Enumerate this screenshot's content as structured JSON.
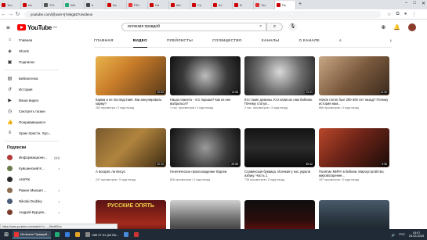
{
  "browser": {
    "tabs": [
      {
        "label": "Тес",
        "color": "#c00"
      },
      {
        "label": "Ис",
        "color": "#c00"
      },
      {
        "label": "TCI",
        "color": "#555"
      },
      {
        "label": "Wh",
        "color": "#2a7"
      },
      {
        "label": "b",
        "color": "#444"
      },
      {
        "label": "Ка",
        "color": "#c00"
      },
      {
        "label": "PDI",
        "color": "#e33"
      },
      {
        "label": "Св",
        "color": "#c00"
      },
      {
        "label": "Ма",
        "color": "#c00"
      },
      {
        "label": "Се",
        "color": "#c00"
      },
      {
        "label": "Ко",
        "color": "#c00"
      },
      {
        "label": "Ф",
        "color": "#c00"
      },
      {
        "label": "Тес",
        "color": "#d33"
      },
      {
        "label": "Ра",
        "color": "#c00"
      }
    ],
    "url": "youtube.com/@user-tj7w6ga57u/videos",
    "status_url": "https://www.youtube.com/watch?v=..._Sbe65Xzs"
  },
  "youtube": {
    "logo_text": "YouTube",
    "logo_region": "RU",
    "search_value": "иллюзия правдой",
    "search_clear": "×"
  },
  "sidebar": {
    "items": [
      {
        "label": "Главная",
        "icon": "home-icon",
        "glyph": "⌂"
      },
      {
        "label": "Shorts",
        "icon": "shorts-icon",
        "glyph": "◈"
      },
      {
        "label": "Подписки",
        "icon": "subscriptions-icon",
        "glyph": "▣"
      }
    ],
    "items2": [
      {
        "label": "Библиотека",
        "icon": "library-icon",
        "glyph": "▤"
      },
      {
        "label": "История",
        "icon": "history-icon",
        "glyph": "↺"
      },
      {
        "label": "Ваши видео",
        "icon": "your-videos-icon",
        "glyph": "▶"
      },
      {
        "label": "Смотреть позже",
        "icon": "watch-later-icon",
        "glyph": "◷"
      },
      {
        "label": "Понравившиеся",
        "icon": "liked-icon",
        "glyph": "👍"
      },
      {
        "label": "Храм Христа. Хро...",
        "icon": "playlist-icon",
        "glyph": "≡"
      }
    ],
    "subs_heading": "Подписки",
    "subs": [
      {
        "label": "Информационн...",
        "color": "#b23b3b",
        "live": "((•))"
      },
      {
        "label": "Кувшинский К...",
        "color": "#6a7b4a",
        "live": "•"
      },
      {
        "label": "AISPIK",
        "color": "#2c2c2c",
        "live": ""
      },
      {
        "label": "Ражин Михаил ...",
        "color": "#8a6d52",
        "live": "•"
      },
      {
        "label": "Nikolai Dudsky",
        "color": "#4b5d7a",
        "live": "•"
      },
      {
        "label": "Андрей Бурцев...",
        "color": "#7a3c2c",
        "live": "•"
      }
    ]
  },
  "channel_tabs": [
    "ГЛАВНАЯ",
    "ВИДЕО",
    "ПЛЕЙЛИСТЫ",
    "СООБЩЕСТВО",
    "КАНАЛЫ",
    "О КАНАЛЕ"
  ],
  "channel_tabs_active": 1,
  "videos": [
    {
      "title": "Карма и ее последствия. Как аннулировать карму?",
      "meta": "262 просмотра • 3 года назад",
      "duration": "20:53",
      "bg": "linear-gradient(135deg,#e9b44c,#c97d2a 40%,#5a3a1a)"
    },
    {
      "title": "Наша планета - это тюрьма? Как из нее выбраться?",
      "meta": "1 тыс. просмотров • 3 года назад",
      "duration": "14:58",
      "bg": "radial-gradient(circle at 50% 50%,#bcbcbc,#3a3a3a 55%,#111)"
    },
    {
      "title": "Кто такие демоны. Кто написал нам библию. Почему статуи...",
      "meta": "2 тыс. просмотров • 3 года назад",
      "duration": "23:21",
      "bg": "radial-gradient(circle at 50% 40%,#d8d8d8,#6e6e6e 50%,#222)"
    },
    {
      "title": "Новое потоп был 300-400 лет назад? Почему история нам...",
      "meta": "686 просмотров • 3 года назад",
      "duration": "11:40",
      "bg": "linear-gradient(135deg,#c9a886,#7b5a3e 50%,#3a2a1c)"
    },
    {
      "title": "А воскрес ли Иисус.",
      "meta": "247 просмотров • 3 года назад",
      "duration": "20:10",
      "bg": "linear-gradient(135deg,#7a5a2e,#b0843e 45%,#3d2a12)"
    },
    {
      "title": "Генетическое происхождение Юдеев.",
      "meta": "826 просмотров • 3 года назад",
      "duration": "26:58",
      "bg": "radial-gradient(circle,#9a9a9a,#3c3c3c 55%,#111)"
    },
    {
      "title": "Славянская буквица. Ипачкая у нас украли азбуку. Часть 1.",
      "meta": "738 просмотров • 3 года назад",
      "duration": "35:42",
      "bg": "linear-gradient(180deg,#141414,#2b2b2b 50%,#0b0b0b)"
    },
    {
      "title": "Понятие МИРА в библии. Мироустройство, мировоззрение...",
      "meta": "287 просмотров • 3 года назад",
      "duration": "9:36",
      "bg": "linear-gradient(135deg,#b9472a,#6d2418 45%,#1a0c08)"
    },
    {
      "title": "",
      "meta": "",
      "duration": "",
      "bg": "linear-gradient(180deg,#5a1414,#a32a1c 60%,#3a0c0c)",
      "overlay": "РУССКИЕ ОПЯТЬ"
    },
    {
      "title": "",
      "meta": "",
      "duration": "",
      "bg": "linear-gradient(180deg,#cfcfcf,#6a6a6a 50%,#1e1e1e)"
    },
    {
      "title": "",
      "meta": "",
      "duration": "",
      "bg": "linear-gradient(180deg,#0e0e0e,#2a0d0d 50%,#8a1010)"
    },
    {
      "title": "",
      "meta": "",
      "duration": "",
      "bg": "linear-gradient(180deg,#4a5a6a,#2a3640 50%,#141a20)"
    }
  ],
  "taskbar": {
    "items": [
      {
        "label": "Иллюзия Правдой...",
        "color": "#e33",
        "active": true
      },
      {
        "label": "",
        "color": "#2a7",
        "active": false
      },
      {
        "label": "",
        "color": "#3a7ee0",
        "active": false
      },
      {
        "label": "",
        "color": "#e5a52a",
        "active": false
      },
      {
        "label": "085 27.01 (64 Bit...",
        "color": "#888",
        "active": false
      },
      {
        "label": "",
        "color": "#4a88d8",
        "active": false
      },
      {
        "label": "",
        "color": "#c33",
        "active": false
      }
    ],
    "lang": "РУС",
    "time": "18:07",
    "date": "25.03.2023"
  }
}
